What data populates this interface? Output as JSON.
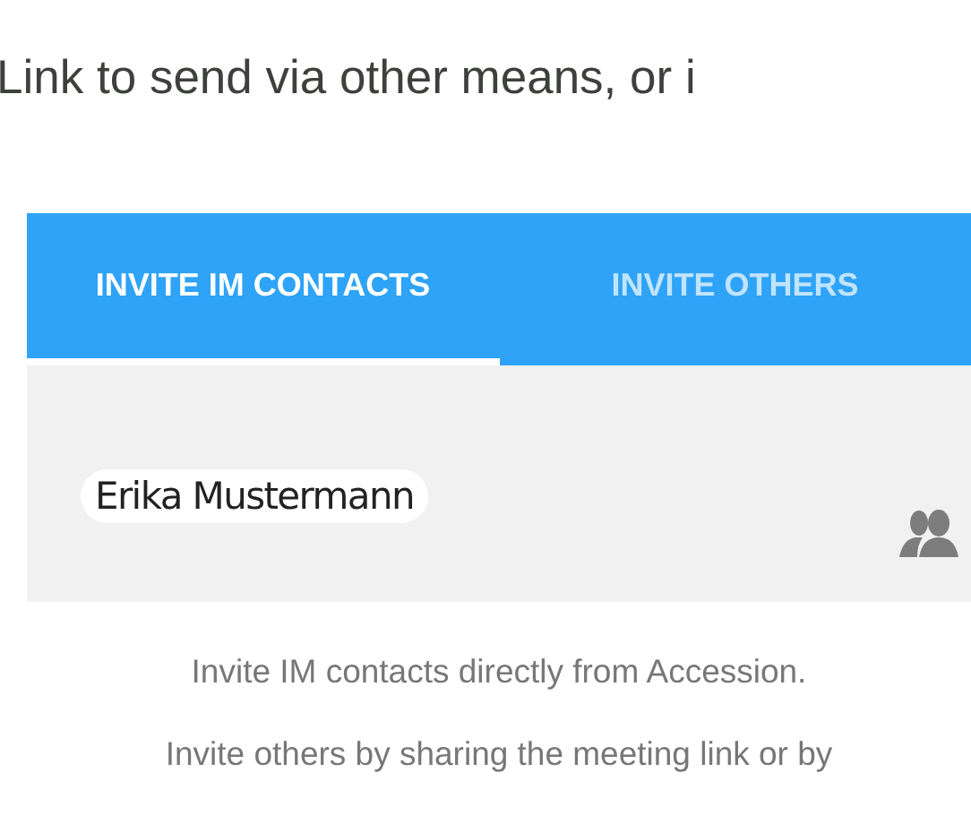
{
  "intro_text": "Link to send via other means, or i",
  "tabs": [
    {
      "label": "INVITE IM CONTACTS",
      "selected": true
    },
    {
      "label": "INVITE OTHERS",
      "selected": false
    }
  ],
  "contacts_field": {
    "chips": [
      "Erika Mustermann"
    ]
  },
  "hints": [
    "Invite IM contacts directly from Accession.",
    "Invite others by sharing the meeting link or by"
  ]
}
